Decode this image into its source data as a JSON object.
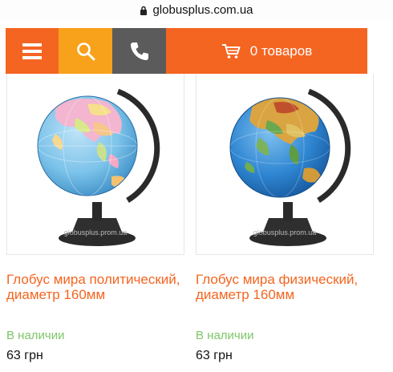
{
  "browser": {
    "url": "globusplus.com.ua"
  },
  "toolbar": {
    "cart_label": "0 товаров",
    "colors": {
      "menu": "#f46522",
      "search": "#f8a11a",
      "phone": "#5b5b5b",
      "cart": "#f46522"
    }
  },
  "products": [
    {
      "title": "Глобус мира политический, диаметр 160мм",
      "availability": "В наличии",
      "price": "63 грн",
      "watermark": "globusplus.prom.ua",
      "globe_type": "political"
    },
    {
      "title": "Глобус мира физический, диаметр 160мм",
      "availability": "В наличии",
      "price": "63 грн",
      "watermark": "globusplus.prom.ua",
      "globe_type": "physical"
    }
  ],
  "colors": {
    "accent": "#f46522",
    "availability": "#7dc66a"
  }
}
